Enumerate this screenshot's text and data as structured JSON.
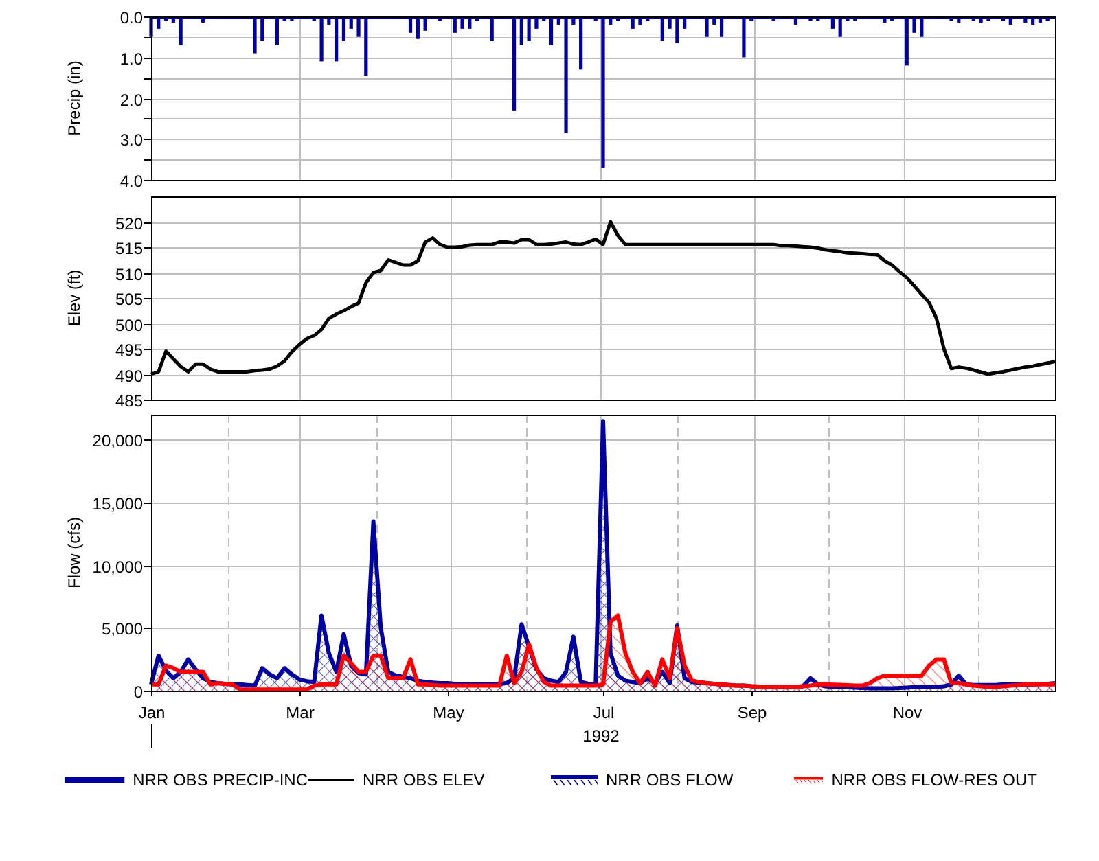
{
  "panels": [
    {
      "chart_data": {
        "type": "bar",
        "grid": true,
        "ylabel": "Precip (in)",
        "ylim": [
          4,
          0
        ],
        "yticks": [
          {
            "value": 0,
            "label": "0.0"
          },
          {
            "value": 1,
            "label": "1.0"
          },
          {
            "value": 2,
            "label": "2.0"
          },
          {
            "value": 3,
            "label": "3.0"
          },
          {
            "value": 4,
            "label": "4.0"
          }
        ],
        "categories": [
          null,
          null,
          null,
          null,
          null,
          null,
          null,
          null,
          null,
          null,
          null,
          null,
          null,
          null,
          null,
          null,
          null,
          null,
          null,
          null,
          null,
          null,
          null,
          null,
          null,
          null,
          null,
          null,
          null,
          null,
          null,
          null,
          null,
          null,
          null,
          null,
          null,
          null,
          null,
          null,
          null,
          null,
          null,
          null,
          null,
          null,
          null,
          null,
          null,
          null,
          null,
          null,
          null,
          null,
          null,
          null,
          null,
          null,
          null,
          null,
          null,
          null,
          null,
          null,
          null,
          null,
          null,
          null,
          null,
          null,
          null,
          null,
          null,
          null,
          null,
          null,
          null,
          null,
          null,
          null,
          null,
          null,
          null,
          null,
          null,
          null,
          null,
          null,
          null,
          null,
          null,
          null,
          null,
          null,
          null,
          null,
          null,
          null,
          null,
          null,
          null,
          null,
          null,
          null,
          null,
          null,
          null,
          null,
          null,
          null,
          null,
          null,
          null,
          null,
          null,
          null,
          null,
          null,
          null,
          null,
          null,
          null,
          null
        ],
        "series": [
          {
            "name": "NRR OBS PRECIP-INC",
            "color": "#0000a0",
            "values": [
              0.5,
              0.3,
              0.1,
              0.15,
              0.7,
              null,
              null,
              0.15,
              null,
              null,
              null,
              null,
              null,
              null,
              0.9,
              0.6,
              null,
              0.7,
              0.1,
              0.05,
              null,
              null,
              0.05,
              1.1,
              0.2,
              1.1,
              0.6,
              0.3,
              0.5,
              1.45,
              null,
              null,
              null,
              null,
              null,
              0.4,
              0.55,
              0.35,
              null,
              0.08,
              null,
              0.4,
              0.3,
              0.3,
              0.1,
              null,
              0.6,
              null,
              null,
              2.3,
              0.7,
              0.6,
              0.3,
              0.1,
              0.7,
              0.2,
              2.85,
              0.2,
              1.3,
              null,
              0.1,
              3.7,
              0.2,
              0.1,
              null,
              0.3,
              0.2,
              0.1,
              null,
              0.6,
              0.3,
              0.65,
              0.3,
              null,
              null,
              0.5,
              0.2,
              0.5,
              null,
              null,
              1.0,
              0.1,
              null,
              null,
              0.1,
              null,
              null,
              0.2,
              null,
              0.1,
              0.05,
              null,
              0.3,
              0.5,
              0.1,
              0.1,
              null,
              null,
              null,
              0.15,
              0.05,
              null,
              1.2,
              0.4,
              0.5,
              null,
              null,
              null,
              0.1,
              0.15,
              null,
              0.1,
              0.15,
              0.05,
              null,
              0.1,
              0.2,
              null,
              0.15,
              0.2,
              0.15,
              0.1,
              null
            ]
          }
        ]
      }
    },
    {
      "chart_data": {
        "type": "line",
        "grid": true,
        "ylabel": "Elev (ft)",
        "ylim": [
          485,
          525
        ],
        "yticks": [
          {
            "value": 485,
            "label": "485"
          },
          {
            "value": 490,
            "label": "490"
          },
          {
            "value": 495,
            "label": "495"
          },
          {
            "value": 500,
            "label": "500"
          },
          {
            "value": 505,
            "label": "505"
          },
          {
            "value": 510,
            "label": "510"
          },
          {
            "value": 515,
            "label": "515"
          },
          {
            "value": 520,
            "label": "520"
          }
        ],
        "categories": [
          null,
          null,
          null,
          null,
          null,
          null,
          null,
          null,
          null,
          null,
          null,
          null,
          null,
          null,
          null,
          null,
          null,
          null,
          null,
          null,
          null,
          null,
          null,
          null,
          null,
          null,
          null,
          null,
          null,
          null,
          null,
          null,
          null,
          null,
          null,
          null,
          null,
          null,
          null,
          null,
          null,
          null,
          null,
          null,
          null,
          null,
          null,
          null,
          null,
          null,
          null,
          null,
          null,
          null,
          null,
          null,
          null,
          null,
          null,
          null,
          null,
          null,
          null,
          null,
          null,
          null,
          null,
          null,
          null,
          null,
          null,
          null,
          null,
          null,
          null,
          null,
          null,
          null,
          null,
          null,
          null,
          null,
          null,
          null,
          null,
          null,
          null,
          null,
          null,
          null,
          null,
          null,
          null,
          null,
          null,
          null,
          null,
          null,
          null,
          null,
          null,
          null,
          null,
          null,
          null,
          null,
          null,
          null,
          null,
          null,
          null,
          null,
          null,
          null,
          null,
          null,
          null,
          null,
          null,
          null,
          null,
          null,
          null
        ],
        "series": [
          {
            "name": "NRR OBS ELEV",
            "color": "#000000",
            "values": [
              490,
              490.5,
              494.5,
              493,
              491.5,
              490.5,
              492,
              492,
              491,
              490.5,
              490.5,
              490.5,
              490.5,
              490.5,
              490.7,
              490.8,
              491,
              491.6,
              492.6,
              494.4,
              495.8,
              497,
              497.6,
              498.8,
              501,
              501.8,
              502.5,
              503.3,
              504,
              508,
              510,
              510.4,
              512.5,
              512,
              511.5,
              511.5,
              512.3,
              516,
              516.8,
              515.5,
              515,
              515,
              515.1,
              515.4,
              515.5,
              515.5,
              515.5,
              516,
              516,
              515.8,
              516.5,
              516.5,
              515.5,
              515.5,
              515.6,
              515.8,
              516,
              515.6,
              515.5,
              516,
              516.6,
              515.5,
              520,
              517.3,
              515.5,
              515.5,
              515.5,
              515.5,
              515.5,
              515.5,
              515.5,
              515.5,
              515.5,
              515.5,
              515.5,
              515.5,
              515.5,
              515.5,
              515.5,
              515.5,
              515.5,
              515.5,
              515.5,
              515.5,
              515.5,
              515.3,
              515.3,
              515.2,
              515.1,
              515,
              514.8,
              514.5,
              514.3,
              514.1,
              513.9,
              513.8,
              513.7,
              513.6,
              513.5,
              512.3,
              511.5,
              510.2,
              509,
              507.4,
              505.7,
              504.1,
              501,
              495,
              491.1,
              491.4,
              491.2,
              490.8,
              490.4,
              490,
              490.3,
              490.5,
              490.8,
              491.1,
              491.4,
              491.6,
              491.9,
              492.2,
              492.5
            ]
          }
        ]
      }
    },
    {
      "chart_data": {
        "type": "area",
        "ylabel": "Flow (cfs)",
        "xlabel": "1992",
        "ylim": [
          0,
          22000
        ],
        "yticks": [
          {
            "value": 0,
            "label": "0"
          },
          {
            "value": 5000,
            "label": "5,000"
          },
          {
            "value": 10000,
            "label": "10,000"
          },
          {
            "value": 15000,
            "label": "15,000"
          },
          {
            "value": 20000,
            "label": "20,000"
          }
        ],
        "categories": [
          "Jan",
          null,
          null,
          null,
          null,
          null,
          null,
          null,
          null,
          null,
          null,
          null,
          null,
          null,
          null,
          null,
          null,
          null,
          null,
          null,
          "Mar",
          null,
          null,
          null,
          null,
          null,
          null,
          null,
          null,
          null,
          null,
          null,
          null,
          null,
          null,
          null,
          null,
          null,
          null,
          null,
          "May",
          null,
          null,
          null,
          null,
          null,
          null,
          null,
          null,
          null,
          null,
          null,
          null,
          null,
          null,
          null,
          null,
          null,
          null,
          null,
          null,
          "Jul",
          null,
          null,
          null,
          null,
          null,
          null,
          null,
          null,
          null,
          null,
          null,
          null,
          null,
          null,
          null,
          null,
          null,
          null,
          null,
          "Sep",
          null,
          null,
          null,
          null,
          null,
          null,
          null,
          null,
          null,
          null,
          null,
          null,
          null,
          null,
          null,
          null,
          null,
          null,
          null,
          null,
          "Nov",
          null,
          null,
          null,
          null,
          null,
          null,
          null,
          null,
          null,
          null,
          null,
          null,
          null,
          null,
          null,
          null,
          null,
          null,
          null,
          null
        ],
        "grid": true,
        "series": [
          {
            "name": "NRR OBS FLOW",
            "color": "#0000a0",
            "values": [
              500,
              2800,
              1600,
              1000,
              1500,
              2500,
              1700,
              1000,
              700,
              600,
              550,
              500,
              500,
              450,
              400,
              1800,
              1300,
              1000,
              1800,
              1300,
              900,
              750,
              700,
              6000,
              3000,
              1500,
              4500,
              2000,
              1400,
              1300,
              13500,
              5000,
              1500,
              1200,
              1100,
              1000,
              800,
              700,
              650,
              600,
              600,
              550,
              550,
              500,
              500,
              500,
              500,
              550,
              600,
              1000,
              5300,
              3500,
              1700,
              1000,
              800,
              700,
              1500,
              4300,
              700,
              550,
              500,
              21500,
              3000,
              1200,
              800,
              700,
              600,
              1000,
              600,
              1500,
              600,
              5200,
              1000,
              700,
              650,
              600,
              550,
              500,
              450,
              400,
              400,
              350,
              330,
              320,
              310,
              300,
              300,
              300,
              350,
              1000,
              500,
              350,
              300,
              300,
              280,
              250,
              220,
              200,
              200,
              200,
              200,
              220,
              250,
              280,
              300,
              300,
              300,
              350,
              500,
              1200,
              500,
              450,
              450,
              450,
              450,
              500,
              500,
              500,
              500,
              500,
              550,
              550,
              600
            ]
          },
          {
            "name": "NRR OBS FLOW-RES OUT",
            "color": "#ff0000",
            "values": [
              500,
              500,
              2000,
              1800,
              1500,
              1500,
              1500,
              1500,
              500,
              600,
              550,
              500,
              100,
              100,
              100,
              100,
              100,
              100,
              100,
              100,
              100,
              100,
              400,
              500,
              500,
              500,
              2800,
              2200,
              1500,
              1500,
              2800,
              2800,
              1000,
              1000,
              1000,
              2500,
              500,
              500,
              450,
              400,
              400,
              400,
              400,
              400,
              400,
              400,
              400,
              400,
              2800,
              600,
              1500,
              3700,
              1800,
              700,
              400,
              400,
              400,
              400,
              400,
              400,
              400,
              500,
              5500,
              6000,
              3000,
              1500,
              600,
              1500,
              400,
              2500,
              1000,
              5000,
              2000,
              800,
              700,
              600,
              550,
              500,
              450,
              400,
              400,
              350,
              330,
              320,
              310,
              300,
              300,
              300,
              350,
              400,
              500,
              500,
              480,
              460,
              440,
              420,
              400,
              600,
              1000,
              1200,
              1200,
              1200,
              1200,
              1200,
              1200,
              2000,
              2500,
              2500,
              600,
              600,
              500,
              400,
              350,
              300,
              300,
              350,
              400,
              450,
              500,
              500,
              500,
              500,
              500
            ]
          }
        ]
      }
    }
  ]
}
